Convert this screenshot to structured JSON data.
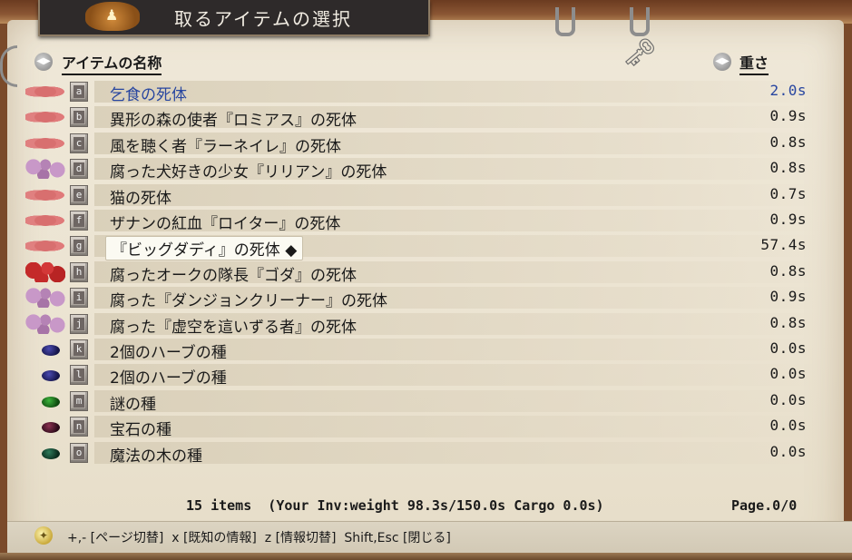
{
  "window": {
    "title": "取るアイテムの選択"
  },
  "header": {
    "name_col": "アイテムの名称",
    "weight_col": "重さ"
  },
  "items": [
    {
      "key": "a",
      "name": "乞食の死体",
      "weight": "2.0s",
      "icon": "corpse-pink"
    },
    {
      "key": "b",
      "name": "異形の森の使者『ロミアス』の死体",
      "weight": "0.9s",
      "icon": "corpse-pink"
    },
    {
      "key": "c",
      "name": "風を聴く者『ラーネイレ』の死体",
      "weight": "0.8s",
      "icon": "corpse-pink"
    },
    {
      "key": "d",
      "name": "腐った犬好きの少女『リリアン』の死体",
      "weight": "0.8s",
      "icon": "corpse-purple"
    },
    {
      "key": "e",
      "name": "猫の死体",
      "weight": "0.7s",
      "icon": "corpse-pink"
    },
    {
      "key": "f",
      "name": "ザナンの紅血『ロイター』の死体",
      "weight": "0.9s",
      "icon": "corpse-pink"
    },
    {
      "key": "g",
      "name": "『ビッグダディ』の死体 ◆",
      "weight": "57.4s",
      "icon": "corpse-pink"
    },
    {
      "key": "h",
      "name": "腐ったオークの隊長『ゴダ』の死体",
      "weight": "0.8s",
      "icon": "corpse-red"
    },
    {
      "key": "i",
      "name": "腐った『ダンジョンクリーナー』の死体",
      "weight": "0.9s",
      "icon": "corpse-purple"
    },
    {
      "key": "j",
      "name": "腐った『虚空を這いずる者』の死体",
      "weight": "0.8s",
      "icon": "corpse-purple"
    },
    {
      "key": "k",
      "name": "2個のハーブの種",
      "weight": "0.0s",
      "icon": "seed-blue"
    },
    {
      "key": "l",
      "name": "2個のハーブの種",
      "weight": "0.0s",
      "icon": "seed-blue"
    },
    {
      "key": "m",
      "name": "謎の種",
      "weight": "0.0s",
      "icon": "seed-green"
    },
    {
      "key": "n",
      "name": "宝石の種",
      "weight": "0.0s",
      "icon": "seed-maroon"
    },
    {
      "key": "o",
      "name": "魔法の木の種",
      "weight": "0.0s",
      "icon": "seed-darkgreen"
    }
  ],
  "status": {
    "summary": "15 items  (Your Inv:weight 98.3s/150.0s Cargo 0.0s)",
    "page": "Page.0/0"
  },
  "help": "+,- [ページ切替]  x [既知の情報]  z [情報切替]  Shift,Esc [閉じる]",
  "colors": {
    "highlight_text": "#2846a0",
    "paper": "#ebe3d1",
    "title_plate": "#2e2a2a"
  }
}
